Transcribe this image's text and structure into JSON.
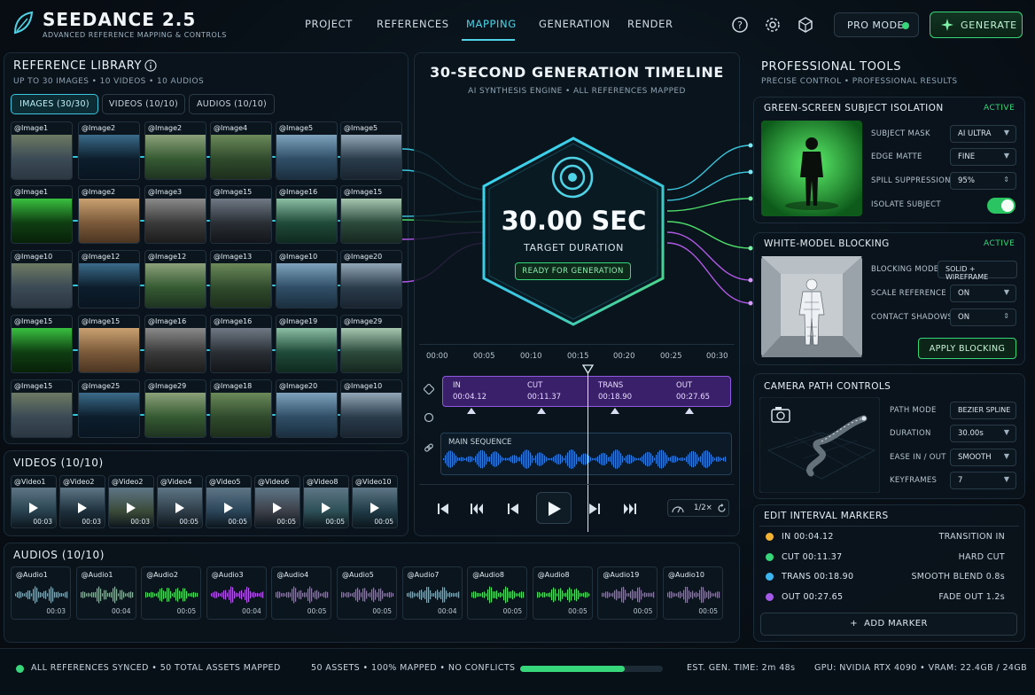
{
  "header": {
    "brand": "SEEDANCE 2.5",
    "brand_sub": "ADVANCED REFERENCE MAPPING & CONTROLS",
    "nav": [
      "PROJECT",
      "REFERENCES",
      "MAPPING",
      "GENERATION",
      "RENDER"
    ],
    "active_nav": "MAPPING",
    "pro_mode": "PRO MODE",
    "generate": "GENERATE",
    "icons": [
      "help-icon",
      "settings-icon",
      "cube-icon"
    ]
  },
  "library": {
    "title": "REFERENCE LIBRARY",
    "sub": "UP TO 30 IMAGES • 10 VIDEOS • 10 AUDIOS",
    "tabs": [
      "IMAGES (30/30)",
      "VIDEOS (10/10)",
      "AUDIOS (10/10)"
    ],
    "images": [
      [
        "@Image1",
        "@Image2",
        "@Image2",
        "@Image4",
        "@Image5",
        "@Image5"
      ],
      [
        "@Image1",
        "@Image2",
        "@Image3",
        "@Image15",
        "@Image16",
        "@Image15"
      ],
      [
        "@Image10",
        "@Image12",
        "@Image12",
        "@Image13",
        "@Image10",
        "@Image20"
      ],
      [
        "@Image15",
        "@Image15",
        "@Image16",
        "@Image16",
        "@Image19",
        "@Image29"
      ],
      [
        "@Image15",
        "@Image25",
        "@Image29",
        "@Image18",
        "@Image20",
        "@Image10"
      ]
    ]
  },
  "videos": {
    "title": "VIDEOS (10/10)",
    "items": [
      {
        "label": "@Video1",
        "dur": "00:03"
      },
      {
        "label": "@Video2",
        "dur": "00:03"
      },
      {
        "label": "@Video2",
        "dur": "00:03"
      },
      {
        "label": "@Video4",
        "dur": "00:05"
      },
      {
        "label": "@Video5",
        "dur": "00:05"
      },
      {
        "label": "@Video6",
        "dur": "00:05"
      },
      {
        "label": "@Video8",
        "dur": "00:05"
      },
      {
        "label": "@Video10",
        "dur": "00:05"
      }
    ]
  },
  "audios": {
    "title": "AUDIOS (10/10)",
    "items": [
      {
        "label": "@Audio1",
        "dur": "00:03",
        "color": "#3cc5e6"
      },
      {
        "label": "@Audio1",
        "dur": "00:04",
        "color": "#4fdc6a"
      },
      {
        "label": "@Audio2",
        "dur": "00:05",
        "color": "#4fdc6a"
      },
      {
        "label": "@Audio3",
        "dur": "00:04",
        "color": "#b25ae8"
      },
      {
        "label": "@Audio4",
        "dur": "00:05",
        "color": "#b25ae8"
      },
      {
        "label": "@Audio5",
        "dur": "00:05",
        "color": "#b25ae8"
      },
      {
        "label": "@Audio7",
        "dur": "00:04",
        "color": "#3cc5e6"
      },
      {
        "label": "@Audio8",
        "dur": "00:05",
        "color": "#4fdc6a"
      },
      {
        "label": "@Audio8",
        "dur": "00:05",
        "color": "#4fdc6a"
      },
      {
        "label": "@Audio19",
        "dur": "00:05",
        "color": "#b25ae8"
      },
      {
        "label": "@Audio10",
        "dur": "00:05",
        "color": "#b25ae8"
      }
    ]
  },
  "timeline": {
    "title": "30-SECOND GENERATION TIMELINE",
    "sub": "AI SYNTHESIS ENGINE • ALL REFERENCES MAPPED",
    "duration": "30.00 SEC",
    "duration_label": "TARGET DURATION",
    "status": "READY FOR GENERATION",
    "ticks": [
      "00:00",
      "00:05",
      "00:10",
      "00:15",
      "00:20",
      "00:25",
      "00:30"
    ],
    "segments": [
      {
        "name": "IN",
        "time": "00:04.12"
      },
      {
        "name": "CUT",
        "time": "00:11.37"
      },
      {
        "name": "TRANS",
        "time": "00:18.90"
      },
      {
        "name": "OUT",
        "time": "00:27.65"
      }
    ],
    "main_sequence": "MAIN SEQUENCE",
    "speed": "1/2×"
  },
  "tools": {
    "title": "PROFESSIONAL TOOLS",
    "sub": "PRECISE CONTROL • PROFESSIONAL RESULTS",
    "green": {
      "title": "GREEN-SCREEN SUBJECT ISOLATION",
      "status": "ACTIVE",
      "rows": [
        {
          "label": "SUBJECT MASK",
          "value": "AI ULTRA"
        },
        {
          "label": "EDGE MATTE",
          "value": "FINE"
        },
        {
          "label": "SPILL SUPPRESSION",
          "value": "95%"
        }
      ],
      "toggle_label": "ISOLATE SUBJECT"
    },
    "white": {
      "title": "WHITE-MODEL BLOCKING",
      "status": "ACTIVE",
      "rows": [
        {
          "label": "BLOCKING MODE",
          "value": "SOLID + WIREFRAME"
        },
        {
          "label": "SCALE REFERENCE",
          "value": "ON"
        },
        {
          "label": "CONTACT SHADOWS",
          "value": "ON"
        }
      ],
      "apply": "APPLY BLOCKING"
    },
    "camera": {
      "title": "CAMERA PATH CONTROLS",
      "rows": [
        {
          "label": "PATH MODE",
          "value": "BEZIER SPLINE"
        },
        {
          "label": "DURATION",
          "value": "30.00s"
        },
        {
          "label": "EASE IN / OUT",
          "value": "SMOOTH"
        },
        {
          "label": "KEYFRAMES",
          "value": "7"
        }
      ]
    },
    "markers": {
      "title": "EDIT INTERVAL MARKERS",
      "items": [
        {
          "name": "IN 00:04.12",
          "transition": "TRANSITION IN",
          "color": "#f2b233"
        },
        {
          "name": "CUT 00:11.37",
          "transition": "HARD CUT",
          "color": "#37d67a"
        },
        {
          "name": "TRANS 00:18.90",
          "transition": "SMOOTH BLEND 0.8s",
          "color": "#3cb6ef"
        },
        {
          "name": "OUT 00:27.65",
          "transition": "FADE OUT 1.2s",
          "color": "#a45ae8"
        }
      ],
      "add": "ADD MARKER"
    }
  },
  "footer": {
    "synced": "ALL REFERENCES SYNCED • 50 TOTAL ASSETS MAPPED",
    "stats": "50 ASSETS • 100% MAPPED • NO CONFLICTS",
    "progress": 0.73,
    "est": "EST. GEN. TIME: 2m 48s",
    "gpu": "GPU: NVIDIA RTX 4090 • VRAM: 22.4GB / 24GB"
  }
}
